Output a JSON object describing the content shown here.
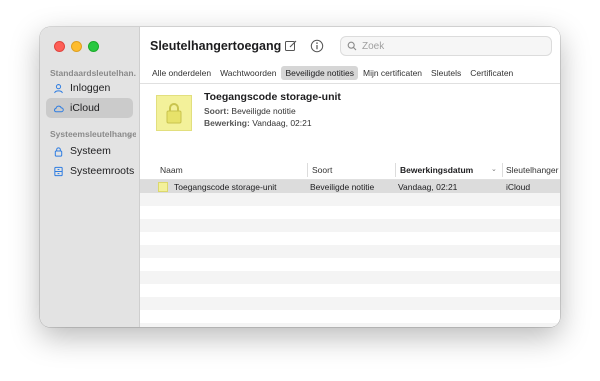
{
  "app": {
    "title": "Sleutelhangertoegang"
  },
  "sidebar": {
    "sections": [
      {
        "heading": "Standaardsleutelhan...",
        "items": [
          {
            "label": "Inloggen",
            "icon": "person-icon",
            "selected": false
          },
          {
            "label": "iCloud",
            "icon": "cloud-icon",
            "selected": true
          }
        ]
      },
      {
        "heading": "Systeemsleutelhange...",
        "items": [
          {
            "label": "Systeem",
            "icon": "lock-icon",
            "selected": false
          },
          {
            "label": "Systeemroots",
            "icon": "cabinet-icon",
            "selected": false
          }
        ]
      }
    ]
  },
  "toolbar": {
    "search": {
      "placeholder": "Zoek",
      "value": ""
    }
  },
  "tabs": [
    {
      "label": "Alle onderdelen",
      "active": false
    },
    {
      "label": "Wachtwoorden",
      "active": false
    },
    {
      "label": "Beveiligde notities",
      "active": true
    },
    {
      "label": "Mijn certificaten",
      "active": false
    },
    {
      "label": "Sleutels",
      "active": false
    },
    {
      "label": "Certificaten",
      "active": false
    }
  ],
  "detail": {
    "name": "Toegangscode storage-unit",
    "kind_label": "Soort:",
    "kind_value": "Beveiligde notitie",
    "modified_label": "Bewerking:",
    "modified_value": "Vandaag, 02:21"
  },
  "table": {
    "columns": [
      "Naam",
      "Soort",
      "Bewerkingsdatum",
      "Sleutelhanger"
    ],
    "sorted_column": "Bewerkingsdatum",
    "rows": [
      {
        "name": "Toegangscode storage-unit",
        "kind": "Beveiligde notitie",
        "date": "Vandaag, 02:21",
        "keychain": "iCloud"
      }
    ]
  },
  "colors": {
    "selection": "#dcdcdc",
    "note_icon": "#f3f19a",
    "sidebar_bg": "#e3e3e3"
  }
}
